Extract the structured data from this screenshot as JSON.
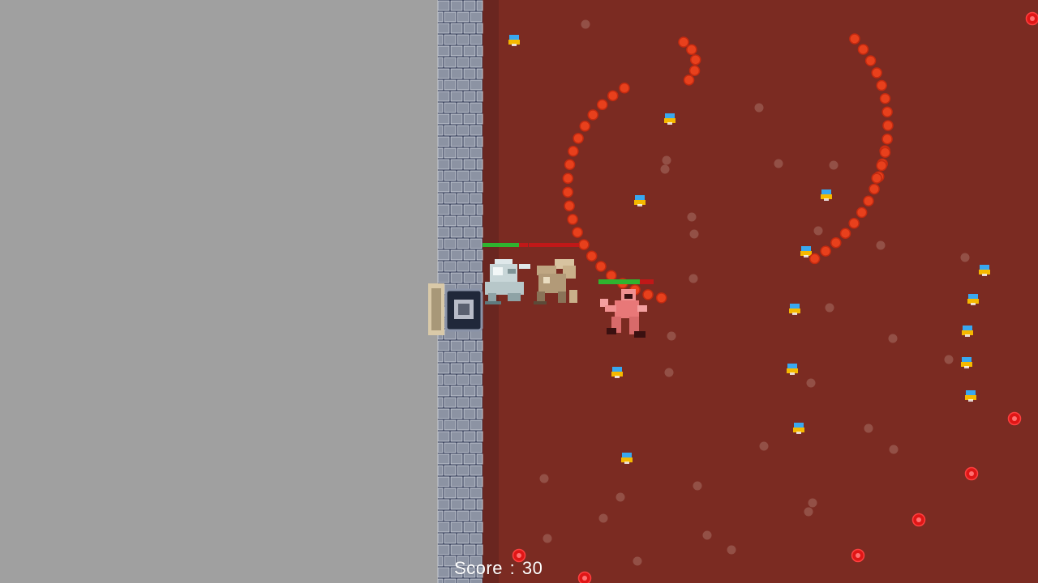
{
  "hud": {
    "score_label": "Score",
    "score_separator": ":",
    "score_value": "30"
  },
  "colors": {
    "void": "#a0a0a0",
    "floor": "#7b2b22",
    "wall": "#1a2340",
    "projectile": "#e8401c",
    "hazard": "#e01616",
    "health_good": "#2fb32f",
    "health_bad": "#c01818",
    "gem_blue": "#38a8f0",
    "gem_gold": "#f5b800"
  },
  "units": {
    "player": {
      "name": "player-ghost-knight",
      "health": 0.8
    },
    "ally": {
      "name": "beige-hound",
      "health": 0.0
    },
    "enemy": {
      "name": "red-fox-warrior",
      "health": 0.75
    }
  }
}
